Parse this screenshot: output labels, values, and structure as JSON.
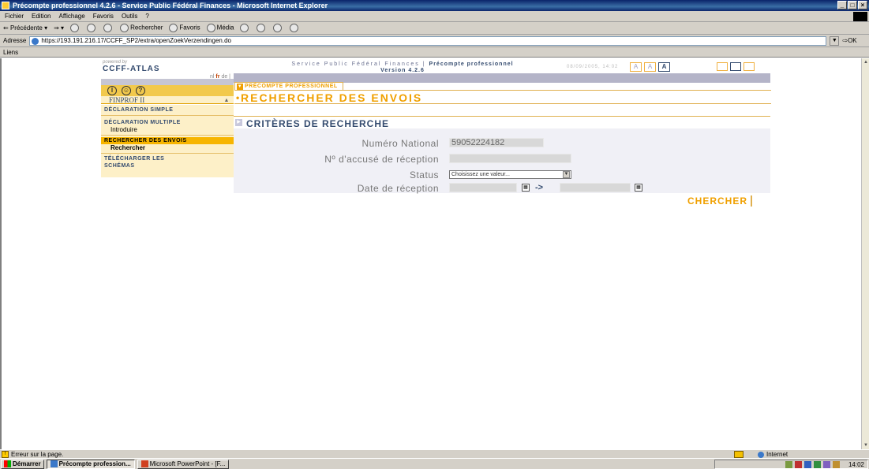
{
  "window": {
    "title": "Précompte professionnel 4.2.6 - Service Public Fédéral Finances - Microsoft Internet Explorer",
    "controls": [
      "_",
      "□",
      "×"
    ]
  },
  "menu": [
    "Fichier",
    "Edition",
    "Affichage",
    "Favoris",
    "Outils",
    "?"
  ],
  "toolbar": {
    "back": "Précédente",
    "search": "Rechercher",
    "favorites": "Favoris",
    "media": "Média"
  },
  "address": {
    "label": "Adresse",
    "url": "https://193.191.216.17/CCFF_SP2/extra/openZoekVerzendingen.do",
    "go": "OK"
  },
  "links": "Liens",
  "brand": {
    "powered_by": "powered by",
    "logo": "CCFF-ATLAS",
    "lang_nl": "nl",
    "lang_fr": "fr",
    "lang_de": "de"
  },
  "header": {
    "service": "Service Public Fédéral Finances",
    "app": "Précompte professionnel",
    "version": "Version 4.2.6",
    "datetime": "08/09/2005, 14:02",
    "font_sizes": [
      "A",
      "A",
      "A"
    ]
  },
  "nav": {
    "icons": [
      "I",
      "☺",
      "?"
    ],
    "app_name": "FINPROF II",
    "collapse": "▲",
    "sections": [
      {
        "label": "DÉCLARATION SIMPLE"
      },
      {
        "label": "DÉCLARATION MULTIPLE",
        "sub": "Introduire"
      },
      {
        "label": "RECHERCHER DES ENVOIS",
        "sub": "Rechercher"
      },
      {
        "label": "TÉLÉCHARGER LES SCHÉMAS"
      }
    ]
  },
  "page": {
    "tab": "PRÉCOMPTE PROFESSIONNEL",
    "title": "RECHERCHER DES ENVOIS",
    "criteria_title": "CRITÈRES DE RECHERCHE",
    "fields": {
      "national_number_label": "Numéro National",
      "national_number_value": "59052224182",
      "receipt_label": "Nº d'accusé de réception",
      "receipt_value": "",
      "status_label": "Status",
      "status_value": "Choisissez une valeur...",
      "date_label": "Date de réception",
      "date_arrow": "->"
    },
    "search_button": "CHERCHER"
  },
  "statusbar": {
    "message": "Erreur sur la page.",
    "zone": "Internet"
  },
  "taskbar": {
    "start": "Démarrer",
    "tasks": [
      "Précompte profession...",
      "Microsoft PowerPoint - [F..."
    ],
    "clock": "14:02"
  }
}
